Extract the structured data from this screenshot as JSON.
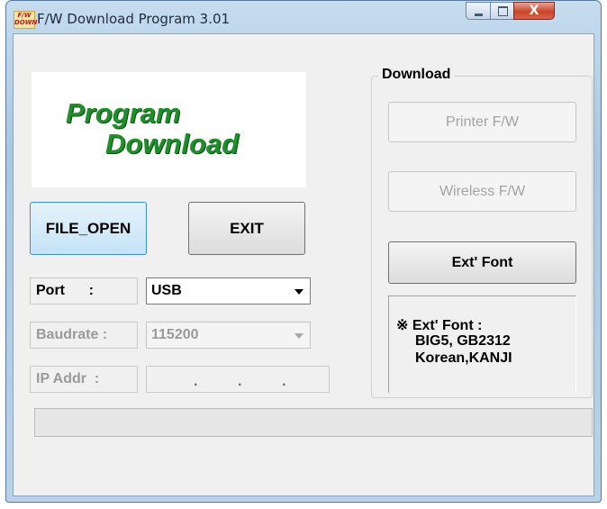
{
  "window": {
    "title": "F/W Download Program 3.01",
    "icon_lines": [
      "F/W",
      "DOWN"
    ],
    "close_glyph": "X"
  },
  "logo": {
    "line1": "Program",
    "line2": "Download"
  },
  "buttons": {
    "file_open": "FILE_OPEN",
    "exit": "EXIT"
  },
  "settings": {
    "port_label": "Port      :",
    "port_value": "USB",
    "baudrate_label": "Baudrate :",
    "baudrate_value": "115200",
    "ip_label": "IP Addr  :",
    "ip_dots": [
      ".",
      ".",
      "."
    ]
  },
  "download": {
    "group_title": "Download",
    "printer_fw": "Printer F/W",
    "wireless_fw": "Wireless F/W",
    "ext_font": "Ext' Font",
    "info_line1": "※ Ext' Font :",
    "info_line2": "BIG5, GB2312",
    "info_line3": "Korean,KANJI"
  },
  "progress": {
    "fraction": 0
  },
  "colors": {
    "logo_green": "#1f8f2a",
    "progress_green": "#06b025"
  }
}
